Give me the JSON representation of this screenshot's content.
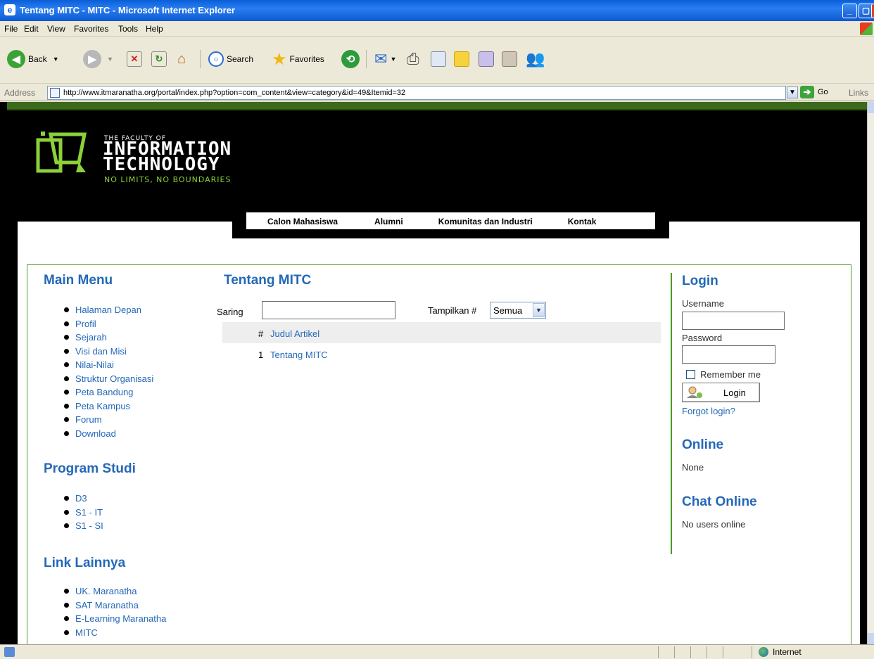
{
  "window": {
    "title": "Tentang MITC - MITC - Microsoft Internet Explorer"
  },
  "menubar": {
    "items": [
      "File",
      "Edit",
      "View",
      "Favorites",
      "Tools",
      "Help"
    ]
  },
  "toolbar": {
    "back_label": "Back",
    "search_label": "Search",
    "favorites_label": "Favorites"
  },
  "address": {
    "label": "Address",
    "url": "http://www.itmaranatha.org/portal/index.php?option=com_content&view=category&id=49&Itemid=32",
    "go_label": "Go",
    "links_label": "Links"
  },
  "site": {
    "logo_line1": "THE FACULTY OF",
    "logo_line2": "INFORMATION",
    "logo_line3": "TECHNOLOGY",
    "logo_tagline": "NO LIMITS, NO BOUNDARIES",
    "nav": [
      "Calon Mahasiswa",
      "Alumni",
      "Komunitas dan Industri",
      "Kontak"
    ]
  },
  "left": {
    "main_menu_title": "Main Menu",
    "main_menu": [
      "Halaman Depan",
      "Profil",
      "Sejarah",
      "Visi dan Misi",
      "Nilai-Nilai",
      "Struktur Organisasi",
      "Peta Bandung",
      "Peta Kampus",
      "Forum",
      "Download"
    ],
    "program_title": "Program Studi",
    "program": [
      "D3",
      "S1 - IT",
      "S1 - SI"
    ],
    "links_title": "Link Lainnya",
    "links": [
      "UK. Maranatha",
      "SAT Maranatha",
      "E-Learning Maranatha",
      "MITC"
    ]
  },
  "center": {
    "title": "Tentang MITC",
    "filter_label": "Saring",
    "display_label": "Tampilkan #",
    "display_value": "Semua",
    "table_headers": [
      "#",
      "Judul Artikel"
    ],
    "rows": [
      {
        "num": "1",
        "title": "Tentang MITC"
      }
    ]
  },
  "right": {
    "login_title": "Login",
    "username_label": "Username",
    "password_label": "Password",
    "remember_label": "Remember me",
    "login_button": "Login",
    "forgot_label": "Forgot login?",
    "online_title": "Online",
    "online_text": "None",
    "chat_title": "Chat Online",
    "chat_text": "No users online"
  },
  "statusbar": {
    "zone": "Internet"
  },
  "colors": {
    "accent_blue": "#2468b8",
    "brand_green": "#8bd13a",
    "frame_green": "#4a9a28"
  }
}
